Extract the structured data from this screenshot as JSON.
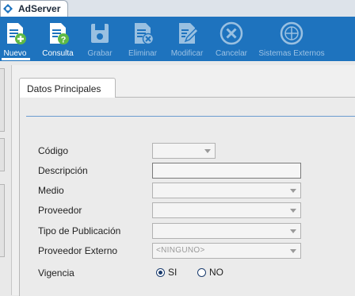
{
  "app": {
    "title": "AdServer"
  },
  "toolbar": {
    "nuevo": "Nuevo",
    "consulta": "Consulta",
    "grabar": "Grabar",
    "eliminar": "Eliminar",
    "modificar": "Modificar",
    "cancelar": "Cancelar",
    "sistemas_externos": "Sistemas Externos"
  },
  "tabs": {
    "main": "Datos Principales"
  },
  "form": {
    "codigo_label": "Código",
    "codigo_value": "",
    "descripcion_label": "Descripción",
    "descripcion_value": "",
    "medio_label": "Medio",
    "medio_value": "",
    "proveedor_label": "Proveedor",
    "proveedor_value": "",
    "tipo_publicacion_label": "Tipo de Publicación",
    "tipo_publicacion_value": "",
    "proveedor_externo_label": "Proveedor Externo",
    "proveedor_externo_value": "<NINGUNO>",
    "vigencia_label": "Vigencia",
    "vigencia_options": [
      "SI",
      "NO"
    ],
    "vigencia_selected": "SI"
  },
  "colors": {
    "toolbar": "#1e73be",
    "tab_line": "#6b9ccf",
    "icon_green": "#5fb946"
  },
  "icons": [
    "adserver-logo",
    "new-document-icon",
    "query-document-icon",
    "save-icon",
    "delete-document-icon",
    "edit-document-icon",
    "cancel-icon",
    "external-systems-icon"
  ]
}
